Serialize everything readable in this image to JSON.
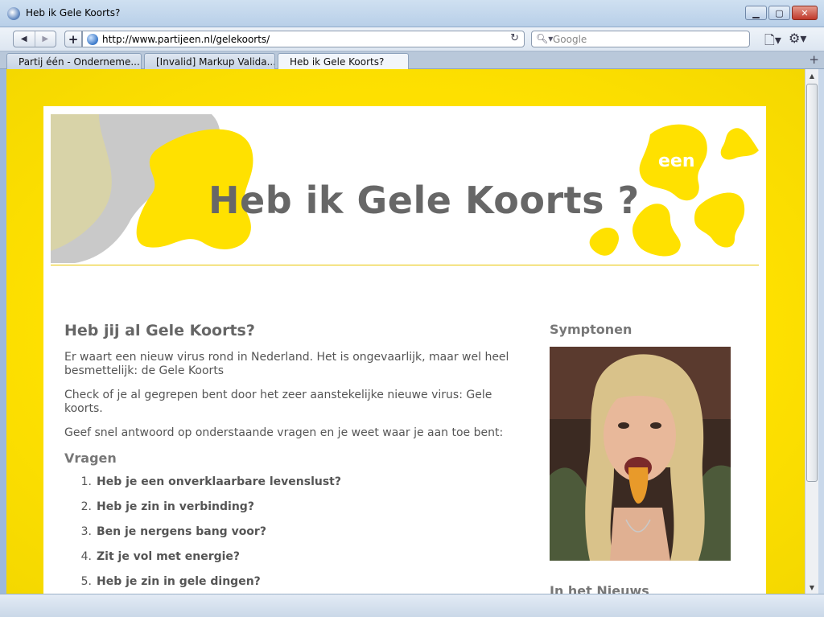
{
  "window": {
    "title": "Heb ik Gele Koorts?"
  },
  "toolbar": {
    "url": "http://www.partijeen.nl/gelekoorts/",
    "search_placeholder": "Google"
  },
  "tabs": [
    {
      "label": "Partij één - Onderneme...",
      "active": false
    },
    {
      "label": "[Invalid] Markup Valida...",
      "active": false
    },
    {
      "label": "Heb ik Gele Koorts?",
      "active": true
    }
  ],
  "page": {
    "banner_title": "Heb ik Gele Koorts ?",
    "banner_logo": "een",
    "heading": "Heb jij al Gele Koorts?",
    "paragraphs": [
      "Er waart een nieuw virus rond in Nederland. Het is ongevaarlijk, maar wel heel besmettelijk: de Gele Koorts",
      "Check of je al gegrepen bent door het zeer aanstekelijke nieuwe virus: Gele koorts.",
      "Geef snel antwoord op onderstaande vragen en je weet waar je aan toe bent:"
    ],
    "questions_heading": "Vragen",
    "questions": [
      {
        "num": "1.",
        "text": "Heb je een onverklaarbare levenslust?"
      },
      {
        "num": "2.",
        "text": "Heb je zin in verbinding?"
      },
      {
        "num": "3.",
        "text": "Ben je nergens bang voor?"
      },
      {
        "num": "4.",
        "text": "Zit je vol met energie?"
      },
      {
        "num": "5.",
        "text": "Heb je zin in gele dingen?"
      }
    ],
    "side_heading": "Symptonen",
    "side_heading_2": "In het Nieuws"
  },
  "colors": {
    "brand_yellow": "#ffe100",
    "text_gray": "#666666"
  },
  "icons": [
    "app-icon",
    "back-icon",
    "forward-icon",
    "new-tab-icon",
    "globe-icon",
    "reload-icon",
    "search-icon",
    "page-menu-icon",
    "gear-icon",
    "minimize-icon",
    "maximize-icon",
    "close-icon",
    "new-tab-plus-icon"
  ]
}
